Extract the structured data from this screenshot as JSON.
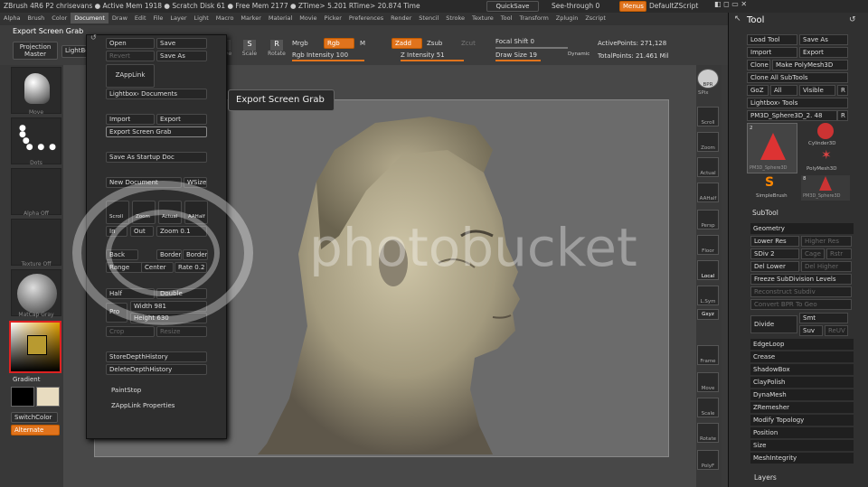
{
  "titlebar": {
    "text": "ZBrush 4R6 P2   chrisevans  ● Active Mem 1918  ● Scratch Disk 61  ● Free Mem 2177  ● ZTime> 5.201 RTime> 20.874 Time",
    "quicksave": "QuickSave",
    "seethrough": "See-through  0",
    "menus": "Menus",
    "script": "DefaultZScript"
  },
  "menubar": [
    "Alpha",
    "Brush",
    "Color",
    "Document",
    "Draw",
    "Edit",
    "File",
    "Layer",
    "Light",
    "Macro",
    "Marker",
    "Material",
    "Movie",
    "Picker",
    "Preferences",
    "Render",
    "Stencil",
    "Stroke",
    "Texture",
    "Tool",
    "Transform",
    "Zplugin",
    "Zscript"
  ],
  "toolbar": {
    "export_title": "Export Screen Grab",
    "projection_master": "Projection Master",
    "lightbox": "LightBox",
    "move": "Move",
    "scale": "Scale",
    "rotate": "Rotate",
    "mrgb": "Mrgb",
    "rgb": "Rgb",
    "m": "M",
    "rgb_intensity": "Rgb Intensity 100",
    "zadd": "Zadd",
    "zsub": "Zsub",
    "zcut": "Zcut",
    "z_intensity": "Z Intensity 51",
    "focal_shift": "Focal Shift 0",
    "draw_size": "Draw Size 19",
    "dynamic": "Dynamic",
    "active_points": "ActivePoints: 271,128",
    "total_points": "TotalPoints: 21.461 Mil"
  },
  "leftshelf": {
    "labels": [
      "Move",
      "Dots",
      "Alpha Off",
      "Texture Off",
      "MatCap Gray"
    ],
    "gradient": "Gradient",
    "switchcolor": "SwitchColor",
    "alternate": "Alternate"
  },
  "docpanel": {
    "open": "Open",
    "save": "Save",
    "revert": "Revert",
    "save_as": "Save As",
    "zapplink": "ZAppLink",
    "lightbox_documents": "Lightbox› Documents",
    "import": "Import",
    "export": "Export",
    "export_screen_grab": "Export Screen Grab",
    "save_as_startup": "Save As Startup Doc",
    "new_document": "New Document",
    "wsize": "WSize",
    "scroll": "Scroll",
    "zoom": "Zoom",
    "actual": "Actual",
    "aahalf": "AAHalf",
    "in": "In",
    "out": "Out",
    "zoom_val": "Zoom 0.1",
    "back": "Back",
    "border": "Border",
    "border2": "Border2",
    "range": "Range",
    "center": "Center",
    "rate": "Rate 0.2",
    "half": "Half",
    "double": "Double",
    "pro": "Pro",
    "width": "Width 981",
    "height": "Height 630",
    "crop": "Crop",
    "resize": "Resize",
    "store_depth": "StoreDepthHistory",
    "delete_depth": "DeleteDepthHistory",
    "paintstop": "PaintStop",
    "zapplink_props": "ZAppLink Properties"
  },
  "tooltip": "Export Screen Grab",
  "rightshelf": [
    "BPR",
    "SPix",
    "Scroll",
    "Zoom",
    "Actual",
    "AAHalf",
    "Persp",
    "Floor",
    "Local",
    "L.Sym",
    "Gxyz",
    "Frame",
    "Move",
    "Scale",
    "Rotate",
    "PolyF"
  ],
  "toolpanel": {
    "title": "Tool",
    "load_tool": "Load Tool",
    "save_as": "Save As",
    "import": "Import",
    "export": "Export",
    "clone": "Clone",
    "make_polymesh": "Make PolyMesh3D",
    "clone_all": "Clone All SubTools",
    "goz": "GoZ",
    "all": "All",
    "visible": "Visible",
    "r": "R",
    "lightbox_tools": "Lightbox› Tools",
    "current_tool": "PM3D_Sphere3D_2. 48",
    "thumbs": [
      "PM3D_Sphere3D",
      "Cylinder3D",
      "PolyMesh3D",
      "SimpleBrush",
      "PM3D_Sphere3D"
    ],
    "thumb_counts": [
      "2",
      "8"
    ],
    "subtool": "SubTool",
    "geometry": "Geometry",
    "lower_res": "Lower Res",
    "higher_res": "Higher Res",
    "sdiv": "SDiv 2",
    "cage": "Cage",
    "rstr": "Rstr",
    "del_lower": "Del Lower",
    "del_higher": "Del Higher",
    "freeze": "Freeze SubDivision Levels",
    "reconstruct": "Reconstruct Subdiv",
    "convert_bpr": "Convert BPR To Geo",
    "divide": "Divide",
    "smt": "Smt",
    "suv": "Suv",
    "reuv": "ReUV",
    "sections": [
      "EdgeLoop",
      "Crease",
      "ShadowBox",
      "ClayPolish",
      "DynaMesh",
      "ZRemesher",
      "Modify Topology",
      "Position",
      "Size",
      "MeshIntegrity"
    ],
    "layers": "Layers"
  },
  "watermark": "photobucket",
  "colors": {
    "accent": "#e0731c",
    "panel": "#303030",
    "viewport": "#6b6b6b"
  }
}
